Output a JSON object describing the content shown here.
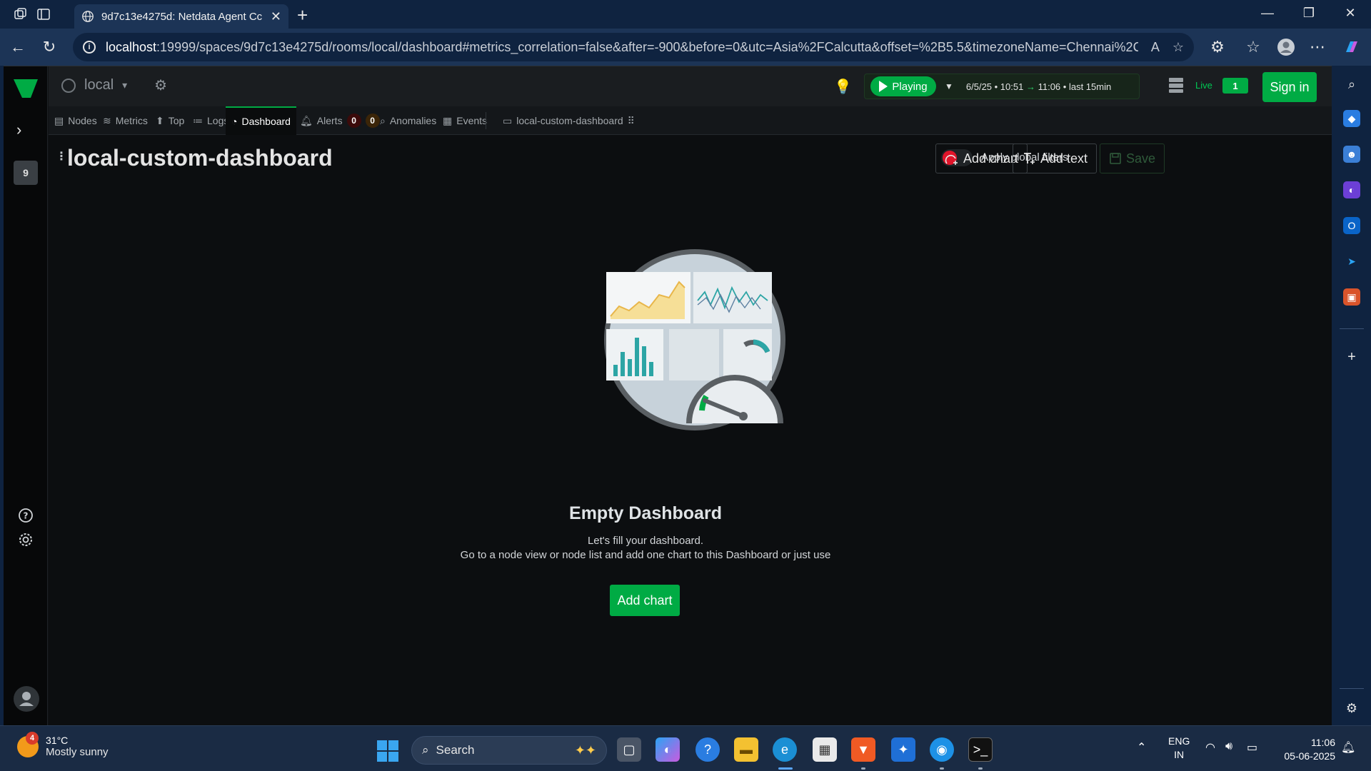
{
  "browser": {
    "tab_title": "9d7c13e4275d: Netdata Agent Cc",
    "url_host": "localhost",
    "url_rest": ":19999/spaces/9d7c13e4275d/rooms/local/dashboard#metrics_correlation=false&after=-900&before=0&utc=Asia%2FCalcutta&offset=%2B5.5&timezoneName=Chennai%2C%..."
  },
  "leftnav": {
    "workspace_badge": "9"
  },
  "header": {
    "room_name": "local",
    "play_label": "Playing",
    "time_start": "6/5/25 • 10:51",
    "time_arrow": "→",
    "time_end": "11:06",
    "time_last": "• last 15min",
    "live_label": "Live",
    "live_count": "1",
    "signin_label": "Sign in"
  },
  "tabs": {
    "nodes": "Nodes",
    "metrics": "Metrics",
    "top": "Top",
    "logs": "Logs",
    "dashboard": "Dashboard",
    "alerts": "Alerts",
    "alerts_critical": "0",
    "alerts_warning": "0",
    "anomalies": "Anomalies",
    "events": "Events",
    "custom": "local-custom-dashboard"
  },
  "dashboard": {
    "title": "local-custom-dashboard",
    "global_filters_label": "Apply global filters",
    "add_chart_label": "Add chart",
    "add_text_label": "Add text",
    "save_label": "Save",
    "empty_title": "Empty Dashboard",
    "empty_line1": "Let's fill your dashboard.",
    "empty_line2": "Go to a node view or node list and add one chart to this Dashboard or just use",
    "empty_button": "Add chart"
  },
  "taskbar": {
    "weather_temp": "31°C",
    "weather_desc": "Mostly sunny",
    "weather_badge": "4",
    "search_label": "Search",
    "lang1": "ENG",
    "lang2": "IN",
    "time": "11:06",
    "date": "05-06-2025"
  },
  "colors": {
    "accent_green": "#00ab44",
    "browser_frame": "#0f2340",
    "app_bg": "#0c0e10"
  }
}
